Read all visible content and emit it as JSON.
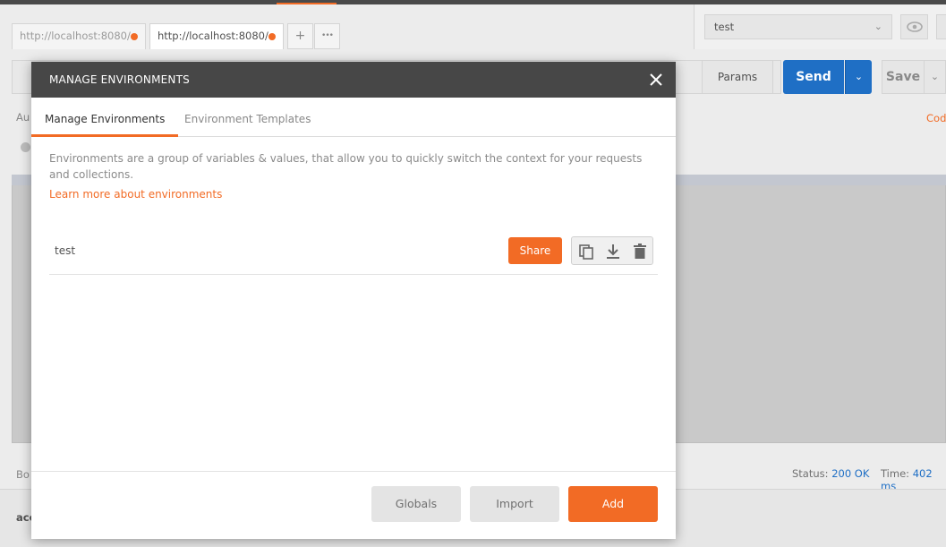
{
  "tabs": [
    {
      "label": "http://localhost:8080/",
      "active": false
    },
    {
      "label": "http://localhost:8080/",
      "active": true
    }
  ],
  "tab_actions": {
    "new_tab": "+",
    "more": "•••"
  },
  "environment_selector": {
    "selected": "test"
  },
  "request": {
    "params_label": "Params",
    "send_label": "Send",
    "save_label": "Save"
  },
  "background": {
    "auth_tab": "Au",
    "code_link": "Cod",
    "body_label": "Bo",
    "status_label": "Status:",
    "status_value": "200 OK",
    "time_label": "Time:",
    "time_value": "402 ms",
    "bottom_text": "acc"
  },
  "modal": {
    "title": "MANAGE ENVIRONMENTS",
    "tabs": [
      "Manage Environments",
      "Environment Templates"
    ],
    "description": "Environments are a group of variables & values, that allow you to quickly switch the context for your requests and collections.",
    "learn_more": "Learn more about environments",
    "environments": [
      {
        "name": "test",
        "share_label": "Share"
      }
    ],
    "footer": {
      "globals_label": "Globals",
      "import_label": "Import",
      "add_label": "Add"
    }
  },
  "colors": {
    "accent": "#f26b25",
    "primary": "#1f6fc5",
    "header": "#474747"
  }
}
